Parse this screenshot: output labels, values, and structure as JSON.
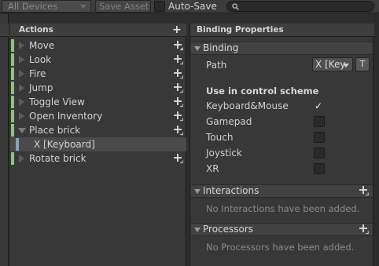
{
  "toolbar": {
    "devices_dropdown": "All Devices",
    "save_asset": "Save Asset",
    "auto_save": "Auto-Save",
    "search_placeholder": ""
  },
  "actions": {
    "header": "Actions",
    "items": [
      {
        "label": "Move"
      },
      {
        "label": "Look"
      },
      {
        "label": "Fire"
      },
      {
        "label": "Jump"
      },
      {
        "label": "Toggle View"
      },
      {
        "label": "Open Inventory"
      },
      {
        "label": "Place brick",
        "expanded": true
      },
      {
        "label": "X [Keyboard]",
        "binding": true,
        "selected": true
      },
      {
        "label": "Rotate brick"
      }
    ]
  },
  "binding_properties": {
    "header": "Binding Properties",
    "binding_section": "Binding",
    "path_label": "Path",
    "path_value": "X [Keyboard]",
    "t_button": "T",
    "control_scheme_title": "Use in control scheme",
    "schemes": [
      {
        "name": "Keyboard&Mouse",
        "checked": true
      },
      {
        "name": "Gamepad",
        "checked": false
      },
      {
        "name": "Touch",
        "checked": false
      },
      {
        "name": "Joystick",
        "checked": false
      },
      {
        "name": "XR",
        "checked": false
      }
    ],
    "interactions_section": "Interactions",
    "interactions_empty": "No Interactions have been added.",
    "processors_section": "Processors",
    "processors_empty": "No Processors have been added."
  },
  "colors": {
    "action_bar": "#8ec27e",
    "binding_bar": "#7ea7b8",
    "background": "#383838"
  }
}
